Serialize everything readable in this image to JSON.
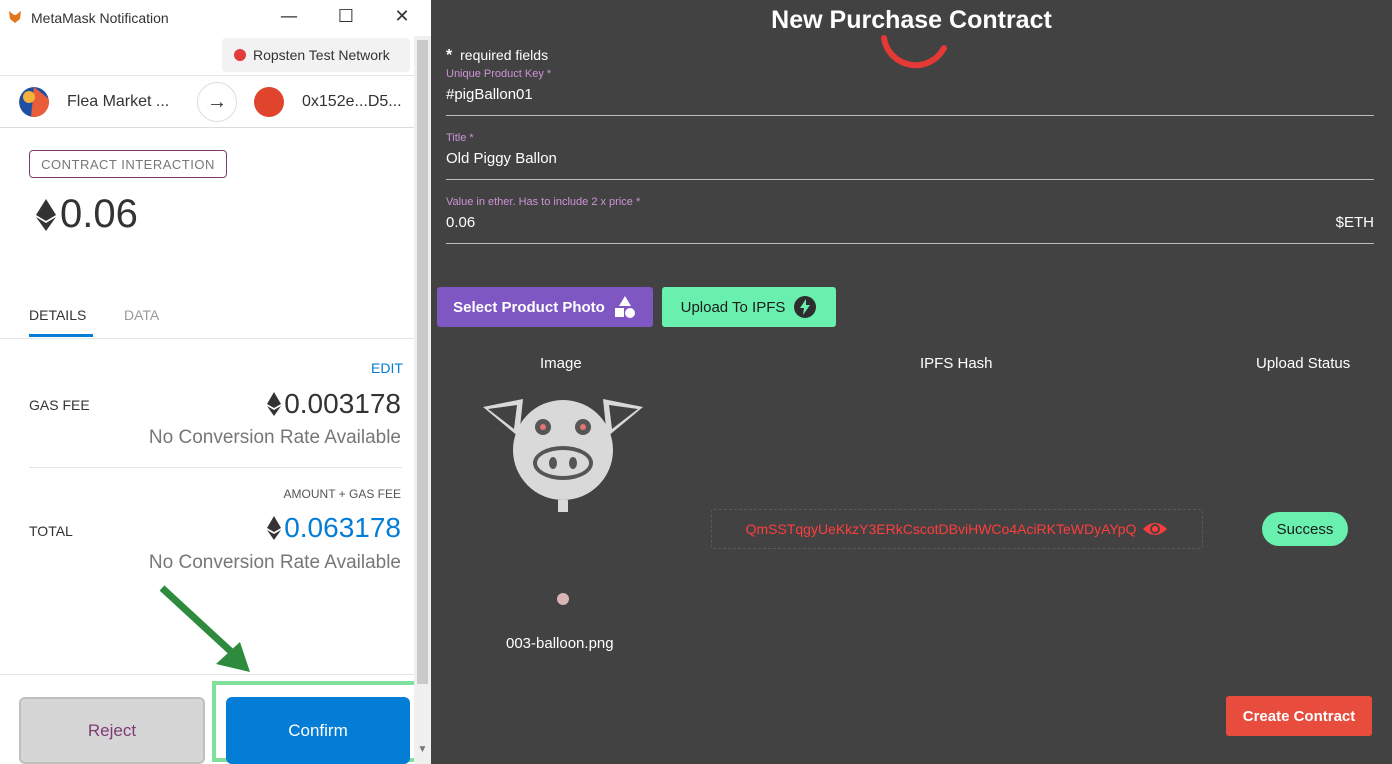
{
  "colors": {
    "app_background": "#424242",
    "accent_purple": "#7e57c2",
    "accent_green": "#69f0ae",
    "hash_red": "#ff3d3d",
    "create_red": "#e74c3c",
    "metamask_blue": "#037dd6",
    "network_dot": "#e23c3c"
  },
  "metamask": {
    "window_title": "MetaMask Notification",
    "window_controls": {
      "minimize": "—",
      "maximize": "☐",
      "close": "✕"
    },
    "network": "Ropsten Test Network",
    "from_name": "Flea Market ...",
    "to_address": "0x152e...D5...",
    "badge": "CONTRACT INTERACTION",
    "amount": "0.06",
    "eth_symbol": "♦",
    "tabs": {
      "details": "DETAILS",
      "data": "DATA"
    },
    "edit": "EDIT",
    "gas_fee_label": "GAS FEE",
    "gas_fee_value": "0.003178",
    "gas_fee_conversion": "No Conversion Rate Available",
    "amount_gas_label": "AMOUNT + GAS FEE",
    "total_label": "TOTAL",
    "total_value": "0.063178",
    "total_conversion": "No Conversion Rate Available",
    "reject": "Reject",
    "confirm": "Confirm"
  },
  "app": {
    "title": "New Purchase Contract",
    "required_star": "*",
    "required_text": "required fields",
    "fields": [
      {
        "label": "Unique Product Key *",
        "value": "#pigBallon01"
      },
      {
        "label": "Title *",
        "value": "Old Piggy Ballon"
      },
      {
        "label": "Value in ether. Has to include 2 x price *",
        "value": "0.06",
        "suffix": "$ETH"
      }
    ],
    "select_photo": "Select Product Photo",
    "upload_ipfs": "Upload To IPFS",
    "headers": {
      "image": "Image",
      "hash": "IPFS Hash",
      "status": "Upload Status"
    },
    "filename": "003-balloon.png",
    "ipfs_hash": "QmSSTqgyUeKkzY3ERkCscotDBviHWCo4AciRKTeWDyAYpQ",
    "status": "Success",
    "create": "Create Contract"
  }
}
